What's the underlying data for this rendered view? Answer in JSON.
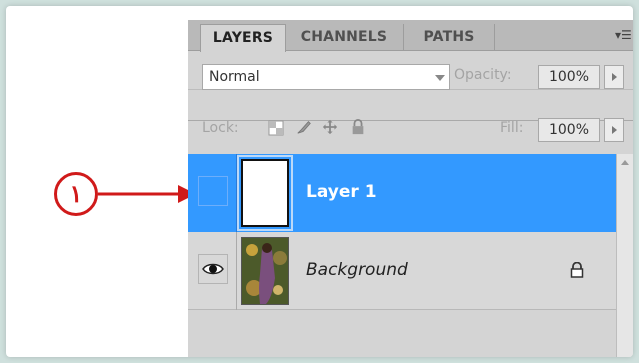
{
  "panel": {
    "tabs": [
      {
        "label": "LAYERS",
        "active": true
      },
      {
        "label": "CHANNELS",
        "active": false
      },
      {
        "label": "PATHS",
        "active": false
      }
    ],
    "menu_icon": "panel-menu-icon"
  },
  "blend_mode": {
    "value": "Normal"
  },
  "opacity": {
    "label": "Opacity:",
    "value": "100%"
  },
  "lock": {
    "label": "Lock:",
    "icons": [
      "lock-transparent-pixels-icon",
      "lock-image-pixels-icon",
      "lock-position-icon",
      "lock-all-icon"
    ]
  },
  "fill": {
    "label": "Fill:",
    "value": "100%"
  },
  "layers": [
    {
      "name": "Layer 1",
      "selected": true,
      "visible": false
    },
    {
      "name": "Background",
      "selected": false,
      "visible": true,
      "locked": true
    }
  ],
  "callout": {
    "number": "١"
  },
  "colors": {
    "selection": "#3399ff",
    "callout": "#d01a1a",
    "panel": "#d4d4d4"
  }
}
